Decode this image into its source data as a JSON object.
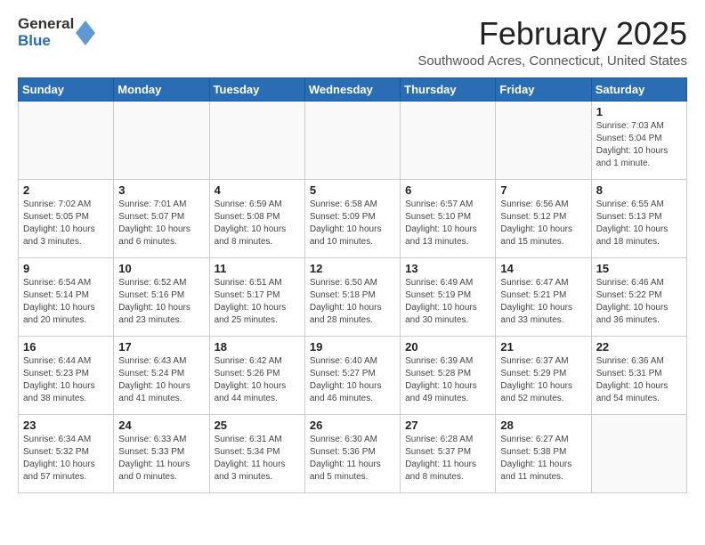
{
  "header": {
    "logo_general": "General",
    "logo_blue": "Blue",
    "title": "February 2025",
    "subtitle": "Southwood Acres, Connecticut, United States"
  },
  "weekdays": [
    "Sunday",
    "Monday",
    "Tuesday",
    "Wednesday",
    "Thursday",
    "Friday",
    "Saturday"
  ],
  "weeks": [
    [
      {
        "day": "",
        "info": ""
      },
      {
        "day": "",
        "info": ""
      },
      {
        "day": "",
        "info": ""
      },
      {
        "day": "",
        "info": ""
      },
      {
        "day": "",
        "info": ""
      },
      {
        "day": "",
        "info": ""
      },
      {
        "day": "1",
        "info": "Sunrise: 7:03 AM\nSunset: 5:04 PM\nDaylight: 10 hours\nand 1 minute."
      }
    ],
    [
      {
        "day": "2",
        "info": "Sunrise: 7:02 AM\nSunset: 5:05 PM\nDaylight: 10 hours\nand 3 minutes."
      },
      {
        "day": "3",
        "info": "Sunrise: 7:01 AM\nSunset: 5:07 PM\nDaylight: 10 hours\nand 6 minutes."
      },
      {
        "day": "4",
        "info": "Sunrise: 6:59 AM\nSunset: 5:08 PM\nDaylight: 10 hours\nand 8 minutes."
      },
      {
        "day": "5",
        "info": "Sunrise: 6:58 AM\nSunset: 5:09 PM\nDaylight: 10 hours\nand 10 minutes."
      },
      {
        "day": "6",
        "info": "Sunrise: 6:57 AM\nSunset: 5:10 PM\nDaylight: 10 hours\nand 13 minutes."
      },
      {
        "day": "7",
        "info": "Sunrise: 6:56 AM\nSunset: 5:12 PM\nDaylight: 10 hours\nand 15 minutes."
      },
      {
        "day": "8",
        "info": "Sunrise: 6:55 AM\nSunset: 5:13 PM\nDaylight: 10 hours\nand 18 minutes."
      }
    ],
    [
      {
        "day": "9",
        "info": "Sunrise: 6:54 AM\nSunset: 5:14 PM\nDaylight: 10 hours\nand 20 minutes."
      },
      {
        "day": "10",
        "info": "Sunrise: 6:52 AM\nSunset: 5:16 PM\nDaylight: 10 hours\nand 23 minutes."
      },
      {
        "day": "11",
        "info": "Sunrise: 6:51 AM\nSunset: 5:17 PM\nDaylight: 10 hours\nand 25 minutes."
      },
      {
        "day": "12",
        "info": "Sunrise: 6:50 AM\nSunset: 5:18 PM\nDaylight: 10 hours\nand 28 minutes."
      },
      {
        "day": "13",
        "info": "Sunrise: 6:49 AM\nSunset: 5:19 PM\nDaylight: 10 hours\nand 30 minutes."
      },
      {
        "day": "14",
        "info": "Sunrise: 6:47 AM\nSunset: 5:21 PM\nDaylight: 10 hours\nand 33 minutes."
      },
      {
        "day": "15",
        "info": "Sunrise: 6:46 AM\nSunset: 5:22 PM\nDaylight: 10 hours\nand 36 minutes."
      }
    ],
    [
      {
        "day": "16",
        "info": "Sunrise: 6:44 AM\nSunset: 5:23 PM\nDaylight: 10 hours\nand 38 minutes."
      },
      {
        "day": "17",
        "info": "Sunrise: 6:43 AM\nSunset: 5:24 PM\nDaylight: 10 hours\nand 41 minutes."
      },
      {
        "day": "18",
        "info": "Sunrise: 6:42 AM\nSunset: 5:26 PM\nDaylight: 10 hours\nand 44 minutes."
      },
      {
        "day": "19",
        "info": "Sunrise: 6:40 AM\nSunset: 5:27 PM\nDaylight: 10 hours\nand 46 minutes."
      },
      {
        "day": "20",
        "info": "Sunrise: 6:39 AM\nSunset: 5:28 PM\nDaylight: 10 hours\nand 49 minutes."
      },
      {
        "day": "21",
        "info": "Sunrise: 6:37 AM\nSunset: 5:29 PM\nDaylight: 10 hours\nand 52 minutes."
      },
      {
        "day": "22",
        "info": "Sunrise: 6:36 AM\nSunset: 5:31 PM\nDaylight: 10 hours\nand 54 minutes."
      }
    ],
    [
      {
        "day": "23",
        "info": "Sunrise: 6:34 AM\nSunset: 5:32 PM\nDaylight: 10 hours\nand 57 minutes."
      },
      {
        "day": "24",
        "info": "Sunrise: 6:33 AM\nSunset: 5:33 PM\nDaylight: 11 hours\nand 0 minutes."
      },
      {
        "day": "25",
        "info": "Sunrise: 6:31 AM\nSunset: 5:34 PM\nDaylight: 11 hours\nand 3 minutes."
      },
      {
        "day": "26",
        "info": "Sunrise: 6:30 AM\nSunset: 5:36 PM\nDaylight: 11 hours\nand 5 minutes."
      },
      {
        "day": "27",
        "info": "Sunrise: 6:28 AM\nSunset: 5:37 PM\nDaylight: 11 hours\nand 8 minutes."
      },
      {
        "day": "28",
        "info": "Sunrise: 6:27 AM\nSunset: 5:38 PM\nDaylight: 11 hours\nand 11 minutes."
      },
      {
        "day": "",
        "info": ""
      }
    ]
  ]
}
